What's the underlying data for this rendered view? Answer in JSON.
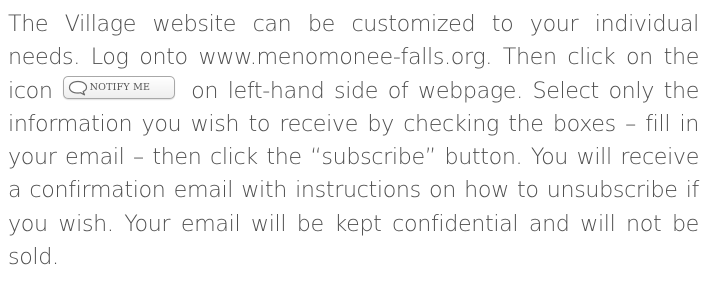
{
  "paragraph": {
    "before_button": "The Village website can be customized to your individual needs. Log onto www.menomonee-falls.org. Then click on the icon",
    "after_button": "on left-hand side of webpage. Select only the information you wish to receive by checking the boxes – fill in your email – then click the “subscribe” button. You will receive a confirmation email with instructions on how to unsubscribe if you wish. Your email will be kept confidential and will not be sold."
  },
  "notify_button": {
    "label": "NOTIFY ME",
    "icon": "speech-bubble-icon"
  }
}
